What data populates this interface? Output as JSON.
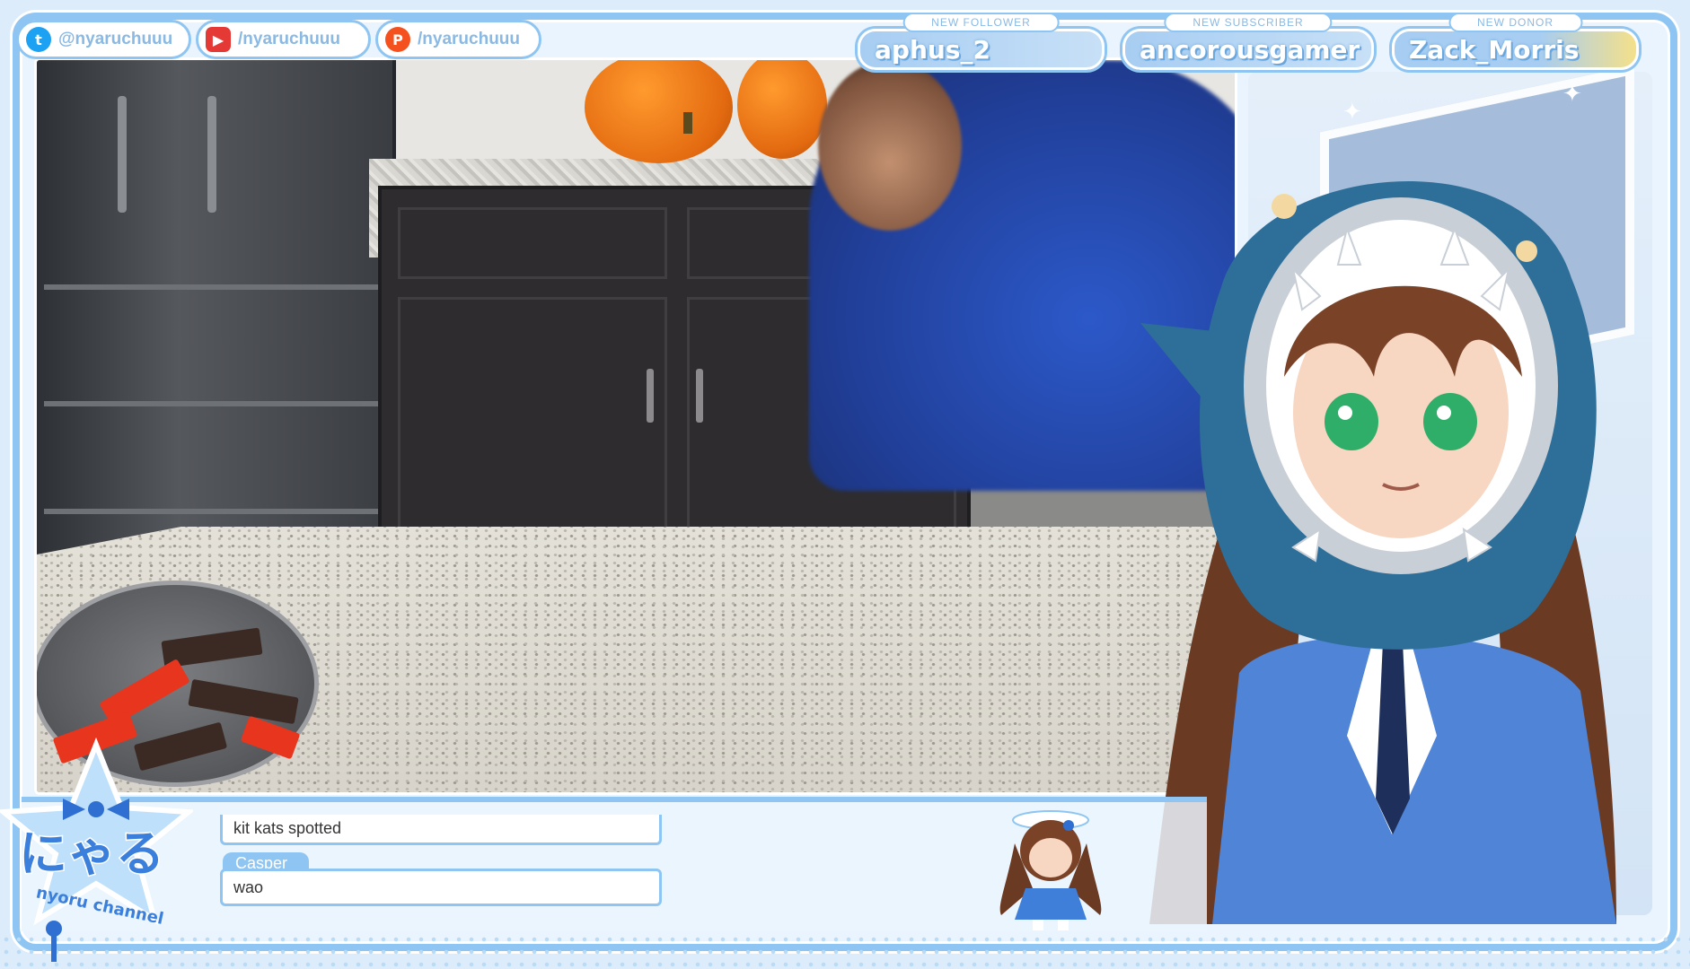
{
  "socials": [
    {
      "platform": "twitter-icon",
      "handle": "@nyaruchuuu",
      "color": "#1da1f2",
      "glyph": "t"
    },
    {
      "platform": "youtube-icon",
      "handle": "/nyaruchuuu",
      "color": "#e53935",
      "glyph": "▶"
    },
    {
      "platform": "patreon-icon",
      "handle": "/nyaruchuuu",
      "color": "#f4511e",
      "glyph": "P"
    }
  ],
  "alerts": {
    "follower": {
      "label": "NEW FOLLOWER",
      "name": "aphus_2"
    },
    "subscriber": {
      "label": "NEW SUBSCRIBER",
      "name": "ancorousgamer"
    },
    "donor": {
      "label": "NEW DONOR",
      "name": "Zack_Morris"
    }
  },
  "chat": {
    "messages": [
      {
        "user": "",
        "text": "kit kats spotted"
      },
      {
        "user": "Casper_",
        "text": "wao"
      }
    ]
  },
  "logo": {
    "kana": "にゃる",
    "subtitle": "nyoru channel"
  },
  "theme": {
    "accent": "#8ec5f2",
    "frame_bg": "#eaf4fe",
    "text_accent": "#8ab9e4"
  }
}
